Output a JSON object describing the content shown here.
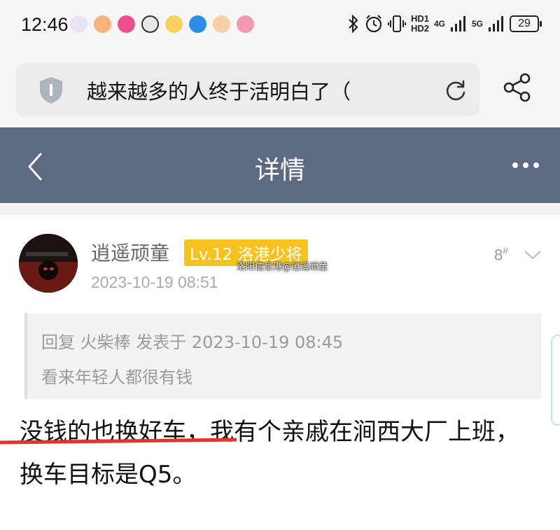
{
  "status_bar": {
    "time": "12:46",
    "hd1": "HD1",
    "hd2": "HD2",
    "net1": "4G",
    "net2": "5G",
    "battery": "29",
    "app_icon_colors": [
      "#e8e4f4",
      "#f8b27c",
      "#f04e8a",
      "#e8e8e8",
      "#f6d25c",
      "#2e8de8",
      "#f7cfa8",
      "#f49ab0"
    ]
  },
  "address_bar": {
    "title": "越来越多的人终于活明白了（"
  },
  "header": {
    "title": "详情"
  },
  "post": {
    "username": "逍遥顽童",
    "level_badge": "Lv.12 洛港少将",
    "timestamp": "2023-10-19 08:51",
    "watermark": "洛阳信息港@逍遥顽童",
    "floor": "8",
    "floor_suffix": "#",
    "avatar_text": "SOUTHERN ALL STARS",
    "quote": {
      "header": "回复 火柴棒 发表于 2023-10-19 08:45",
      "body": "看来年轻人都很有钱"
    },
    "content": "没钱的也换好车，我有个亲戚在涧西大厂上班，换车目标是Q5。"
  },
  "colors": {
    "header_bg": "#5d6b82",
    "level_badge_bg": "#f6c31e",
    "underline": "#e0342c"
  }
}
